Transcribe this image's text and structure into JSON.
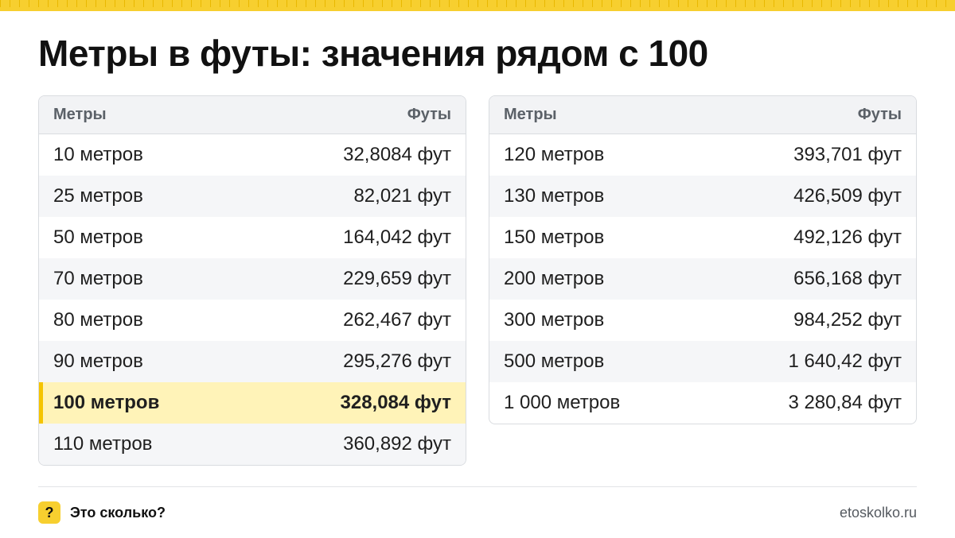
{
  "title": "Метры в футы: значения рядом с 100",
  "colors": {
    "accent": "#f7cf2f",
    "highlight_bg": "#fff3b8",
    "highlight_bar": "#f5c400"
  },
  "tables": [
    {
      "header": {
        "meters": "Метры",
        "feet": "Футы"
      },
      "rows": [
        {
          "meters": "10 метров",
          "feet": "32,8084 фут"
        },
        {
          "meters": "25 метров",
          "feet": "82,021 фут"
        },
        {
          "meters": "50 метров",
          "feet": "164,042 фут"
        },
        {
          "meters": "70 метров",
          "feet": "229,659 фут"
        },
        {
          "meters": "80 метров",
          "feet": "262,467 фут"
        },
        {
          "meters": "90 метров",
          "feet": "295,276 фут"
        },
        {
          "meters": "100 метров",
          "feet": "328,084 фут",
          "highlighted": true
        },
        {
          "meters": "110 метров",
          "feet": "360,892 фут"
        }
      ]
    },
    {
      "header": {
        "meters": "Метры",
        "feet": "Футы"
      },
      "rows": [
        {
          "meters": "120 метров",
          "feet": "393,701 фут"
        },
        {
          "meters": "130 метров",
          "feet": "426,509 фут"
        },
        {
          "meters": "150 метров",
          "feet": "492,126 фут"
        },
        {
          "meters": "200 метров",
          "feet": "656,168 фут"
        },
        {
          "meters": "300 метров",
          "feet": "984,252 фут"
        },
        {
          "meters": "500 метров",
          "feet": "1 640,42 фут"
        },
        {
          "meters": "1 000 метров",
          "feet": "3 280,84 фут"
        }
      ]
    }
  ],
  "footer": {
    "badge": "?",
    "brand": "Это сколько?",
    "site": "etoskolko.ru",
    "badge_icon": "question-mark-icon"
  }
}
